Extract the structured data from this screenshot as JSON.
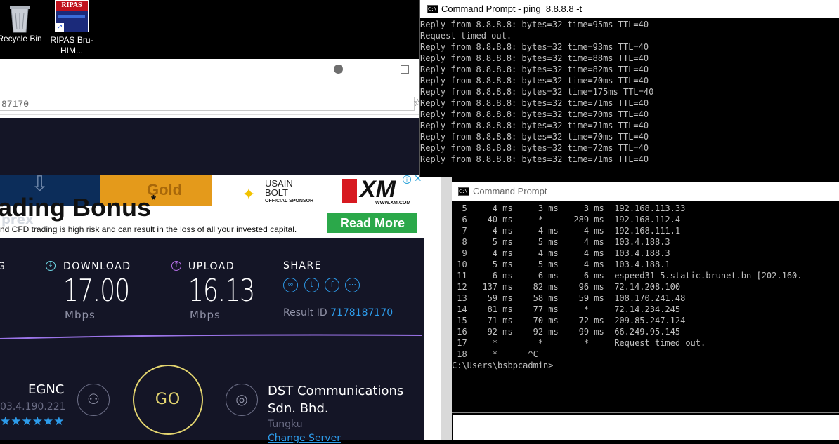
{
  "desktop": {
    "icons": [
      {
        "label": "Recycle Bin"
      },
      {
        "label": "RIPAS Bru-HIM..."
      }
    ],
    "ripas_logo_text": "RIPAS"
  },
  "browser": {
    "url_fragment": "87170"
  },
  "ad": {
    "headline": "ading Bonus",
    "asterisk": "*",
    "disclaimer": "nd CFD trading is high risk and can result in the loss of all your invested capital.",
    "sponsor_line1": "USAIN",
    "sponsor_line2": "BOLT",
    "sponsor_line3": "OFFICIAL SPONSOR",
    "brand": "XM",
    "brand_url": "WWW.XM.COM",
    "cta": "Read More",
    "gold_label": "Gold",
    "faded_text": "prex"
  },
  "speedtest": {
    "download_label": "DOWNLOAD",
    "download_value": "17.00",
    "download_unit": "Mbps",
    "upload_label": "UPLOAD",
    "upload_value": "16.13",
    "upload_unit": "Mbps",
    "share_label": "SHARE",
    "result_label": "Result ID",
    "result_id": "7178187170",
    "left_cut_label": "G",
    "isp_name": "EGNC",
    "isp_ip": "03.4.190.221",
    "rating_stars": 6,
    "go_label": "GO",
    "server_name_line1": "DST Communications",
    "server_name_line2": "Sdn. Bhd.",
    "server_location": "Tungku",
    "change_server": "Change Server"
  },
  "cmd_ping": {
    "title": "Command Prompt - ping  8.8.8.8 -t",
    "lines": [
      "Reply from 8.8.8.8: bytes=32 time=95ms TTL=40",
      "Request timed out.",
      "Reply from 8.8.8.8: bytes=32 time=93ms TTL=40",
      "Reply from 8.8.8.8: bytes=32 time=88ms TTL=40",
      "Reply from 8.8.8.8: bytes=32 time=82ms TTL=40",
      "Reply from 8.8.8.8: bytes=32 time=70ms TTL=40",
      "Reply from 8.8.8.8: bytes=32 time=175ms TTL=40",
      "Reply from 8.8.8.8: bytes=32 time=71ms TTL=40",
      "Reply from 8.8.8.8: bytes=32 time=70ms TTL=40",
      "Reply from 8.8.8.8: bytes=32 time=71ms TTL=40",
      "Reply from 8.8.8.8: bytes=32 time=70ms TTL=40",
      "Reply from 8.8.8.8: bytes=32 time=72ms TTL=40",
      "Reply from 8.8.8.8: bytes=32 time=71ms TTL=40"
    ]
  },
  "cmd_tracert": {
    "title": "Command Prompt",
    "lines": [
      "  5     4 ms     3 ms     3 ms  192.168.113.33",
      "  6    40 ms     *      289 ms  192.168.112.4",
      "  7     4 ms     4 ms     4 ms  192.168.111.1",
      "  8     5 ms     5 ms     4 ms  103.4.188.3",
      "  9     4 ms     4 ms     4 ms  103.4.188.3",
      " 10     5 ms     5 ms     4 ms  103.4.188.1",
      " 11     6 ms     6 ms     6 ms  espeed31-5.static.brunet.bn [202.160.",
      " 12   137 ms    82 ms    96 ms  72.14.208.100",
      " 13    59 ms    58 ms    59 ms  108.170.241.48",
      " 14    81 ms    77 ms     *     72.14.234.245",
      " 15    71 ms    70 ms    72 ms  209.85.247.124",
      " 16    92 ms    92 ms    99 ms  66.249.95.145",
      " 17     *        *        *     Request timed out.",
      " 18     *      ^C"
    ],
    "prompt": "C:\\Users\\bsbpcadmin>"
  }
}
